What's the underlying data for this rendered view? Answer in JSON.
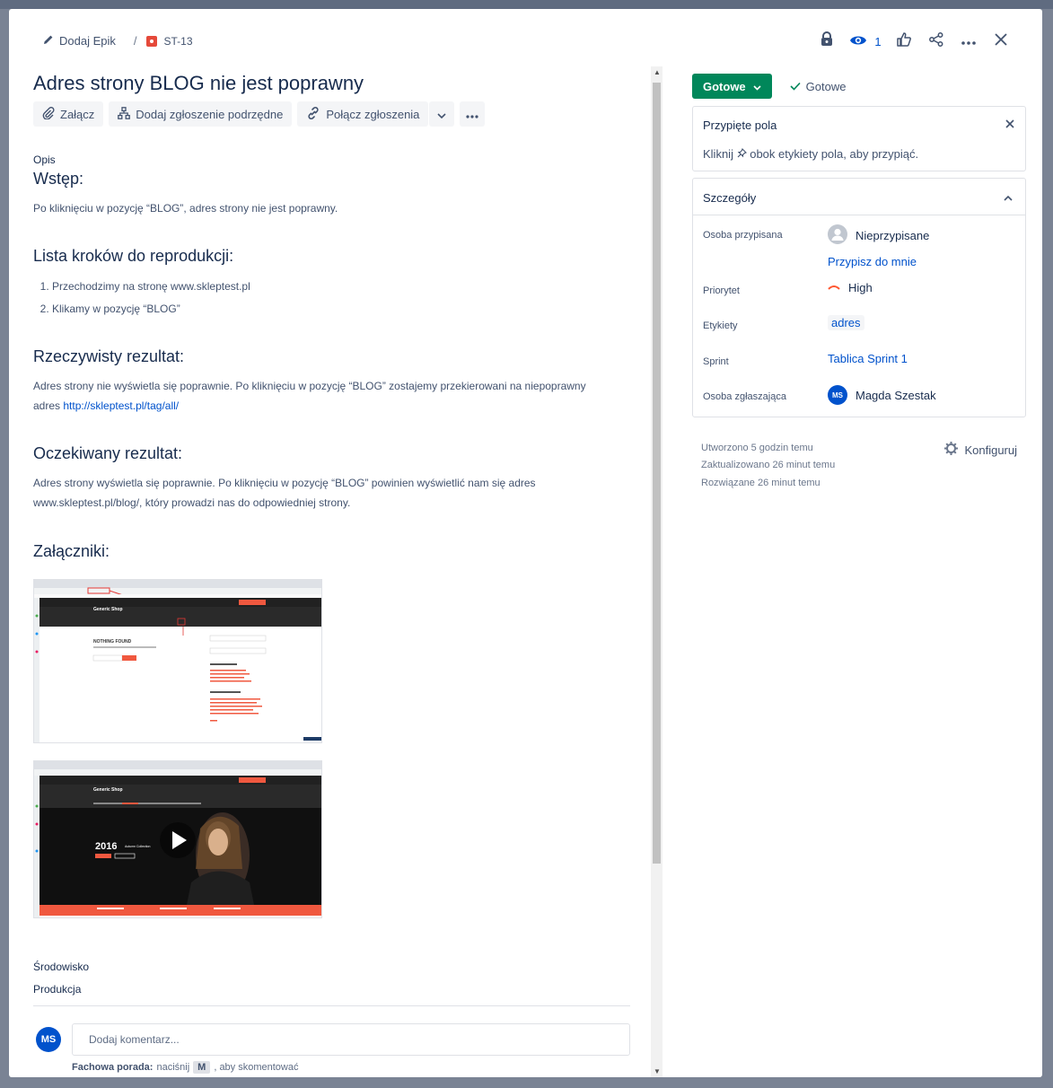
{
  "breadcrumb": {
    "epic_label": "Dodaj Epik",
    "separator": "/",
    "issue_key": "ST-13"
  },
  "header_actions": {
    "watch_count": "1"
  },
  "issue": {
    "title": "Adres strony BLOG nie jest poprawny",
    "buttons": {
      "attach": "Załącz",
      "add_child": "Dodaj zgłoszenie podrzędne",
      "link": "Połącz zgłoszenia"
    }
  },
  "description": {
    "label": "Opis",
    "h_intro": "Wstęp:",
    "p_intro": "Po kliknięciu w pozycję “BLOG”, adres strony nie jest poprawny.",
    "h_steps": "Lista kroków do reprodukcji:",
    "steps": [
      "Przechodzimy na stronę www.skleptest.pl",
      "Klikamy w pozycję “BLOG”"
    ],
    "h_actual": "Rzeczywisty rezultat:",
    "p_actual_1": "Adres strony nie wyświetla się poprawnie. Po kliknięciu w pozycję “BLOG” zostajemy przekierowani na niepoprawny",
    "p_actual_2": "adres",
    "p_actual_link": "http://skleptest.pl/tag/all/",
    "h_expected": "Oczekiwany rezultat:",
    "p_expected_1": "Adres strony wyświetla się poprawnie. Po kliknięciu w pozycję “BLOG” powinien wyświetlić nam się adres",
    "p_expected_2": "www.skleptest.pl/blog/, który prowadzi nas do odpowiedniej strony.",
    "h_attachments": "Załączniki:"
  },
  "attachments": {
    "shop_name": "Generic Shop",
    "nothing_found": "NOTHING FOUND",
    "hero_year": "2016",
    "hero_caption": "Autumn Collection"
  },
  "environment": {
    "label": "Środowisko",
    "value": "Produkcja"
  },
  "comment": {
    "avatar_initials": "MS",
    "placeholder": "Dodaj komentarz...",
    "tip_bold": "Fachowa porada:",
    "tip_pre": "naciśnij",
    "tip_key": "M",
    "tip_post": ", aby skomentować"
  },
  "status": {
    "button_label": "Gotowe",
    "resolution_label": "Gotowe",
    "button_color": "#00875a"
  },
  "pinned": {
    "title": "Przypięte pola",
    "hint_pre": "Kliknij",
    "hint_post": "obok etykiety pola, aby przypiąć."
  },
  "details": {
    "title": "Szczegóły",
    "assignee_label": "Osoba przypisana",
    "assignee_value": "Nieprzypisane",
    "assign_me": "Przypisz do mnie",
    "priority_label": "Priorytet",
    "priority_value": "High",
    "labels_label": "Etykiety",
    "labels_value": "adres",
    "sprint_label": "Sprint",
    "sprint_value": "Tablica Sprint 1",
    "reporter_label": "Osoba zgłaszająca",
    "reporter_initials": "MS",
    "reporter_value": "Magda Szestak"
  },
  "meta": {
    "created": "Utworzono 5 godzin temu",
    "updated": "Zaktualizowano 26 minut temu",
    "resolved": "Rozwiązane 26 minut temu",
    "configure": "Konfiguruj"
  }
}
